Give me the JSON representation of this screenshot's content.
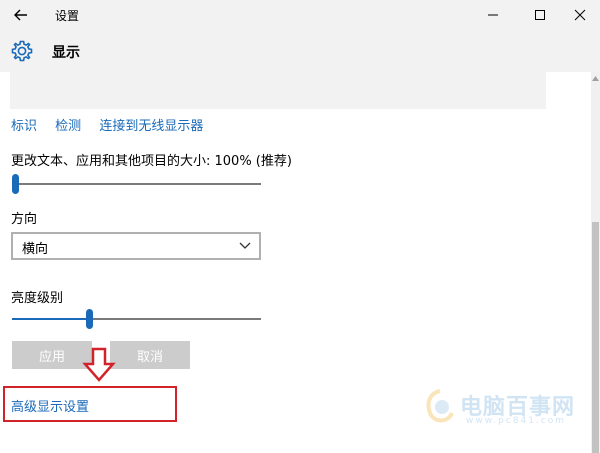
{
  "window": {
    "title": "设置",
    "back_icon": "back-arrow-icon",
    "minimize_icon": "minimize-icon",
    "maximize_icon": "maximize-icon",
    "close_icon": "close-icon"
  },
  "header": {
    "icon": "gear-icon",
    "title": "显示"
  },
  "links": [
    {
      "label": "标识"
    },
    {
      "label": "检测"
    },
    {
      "label": "连接到无线显示器"
    }
  ],
  "scale": {
    "label": "更改文本、应用和其他项目的大小: 100% (推荐)",
    "slider_level": 0
  },
  "orientation": {
    "label": "方向",
    "selected": "横向"
  },
  "brightness": {
    "label": "亮度级别",
    "slider_level": 0.31
  },
  "buttons": {
    "apply": "应用",
    "cancel": "取消"
  },
  "advanced": {
    "label": "高级显示设置"
  },
  "watermark": {
    "text": "电脑百事网",
    "sub": "www.pc841.com"
  },
  "colors": {
    "accent": "#1a6ab9",
    "highlight_border": "#d1232a",
    "disabled_button": "#cccccc"
  }
}
